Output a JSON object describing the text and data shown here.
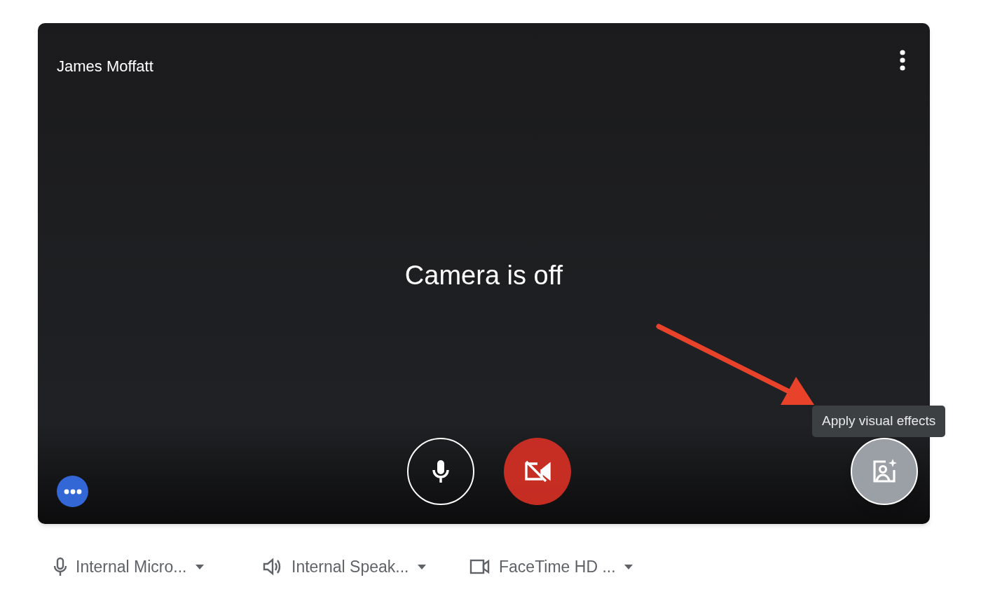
{
  "tile": {
    "participant_name": "James Moffatt",
    "status_text": "Camera is off"
  },
  "controls": [
    {
      "kind": "mic",
      "on": true
    },
    {
      "kind": "camera",
      "on": false
    }
  ],
  "effects_button": {
    "tooltip": "Apply visual effects"
  },
  "devices": [
    {
      "kind": "mic",
      "label": "Internal Micro..."
    },
    {
      "kind": "speaker",
      "label": "Internal Speak..."
    },
    {
      "kind": "camera",
      "label": "FaceTime HD ..."
    }
  ]
}
